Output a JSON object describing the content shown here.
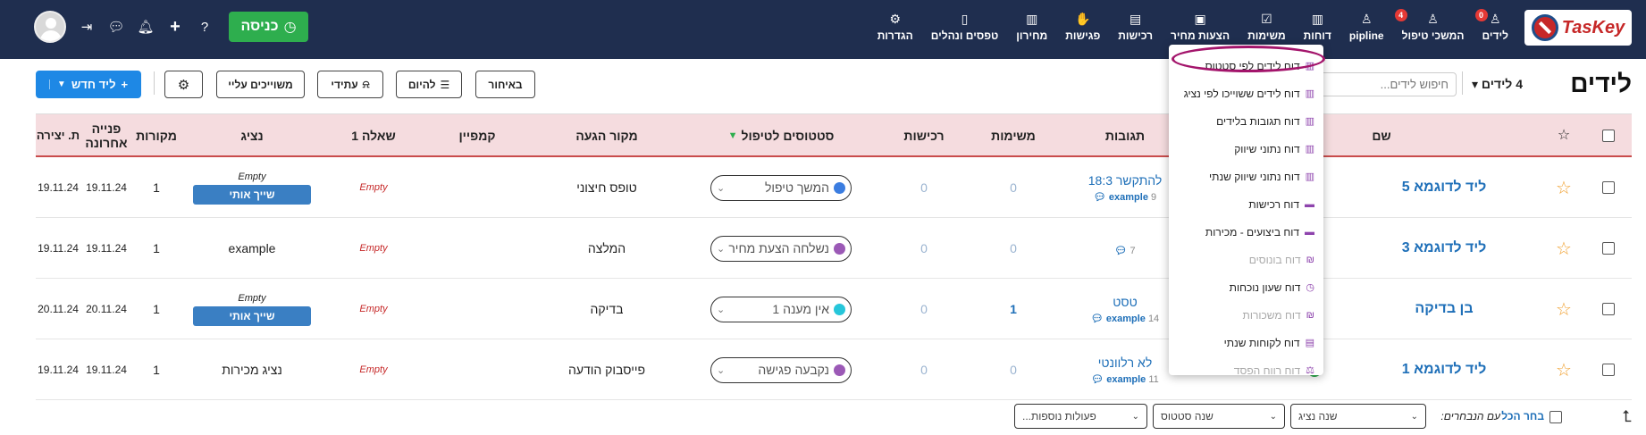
{
  "nav": {
    "logo": "TasKey",
    "items": [
      {
        "label": "לידים",
        "icon": "users-icon",
        "badge": "0"
      },
      {
        "label": "המשכי טיפול",
        "icon": "user-followup-icon",
        "badge": "4"
      },
      {
        "label": "pipline",
        "icon": "pipeline-icon",
        "badge": ""
      },
      {
        "label": "דוחות",
        "icon": "bar-chart-icon",
        "badge": ""
      },
      {
        "label": "משימות",
        "icon": "checkbox-icon",
        "badge": ""
      },
      {
        "label": "הצעות מחיר",
        "icon": "quote-icon",
        "badge": ""
      },
      {
        "label": "רכישות",
        "icon": "purchase-icon",
        "badge": ""
      },
      {
        "label": "פגישות",
        "icon": "handshake-icon",
        "badge": ""
      },
      {
        "label": "מחירון",
        "icon": "barcode-icon",
        "badge": ""
      },
      {
        "label": "טפסים ונהלים",
        "icon": "forms-icon",
        "badge": ""
      },
      {
        "label": "הגדרות",
        "icon": "gear-icon",
        "badge": ""
      }
    ],
    "enter_button": "כניסה"
  },
  "header": {
    "title": "לידים",
    "leads_count": "4 לידים",
    "search_placeholder": "חיפוש לידים...",
    "btn_late": "באיחור",
    "btn_today": "להיום",
    "btn_future": "עתידי",
    "btn_assigned": "משוייכים עליי",
    "btn_new_lead": "ליד חדש"
  },
  "table": {
    "headers": {
      "name": "שם",
      "tags": "תגובות",
      "tasks": "משימות",
      "purchases": "רכישות",
      "status": "סטטוסים לטיפול",
      "source": "מקור הגעה",
      "campaign": "קמפיין",
      "question": "שאלה 1",
      "agent": "נציג",
      "sources": "מקורות",
      "last_contact": "פנייה אחרונה",
      "created": "ת. יצירה"
    },
    "rows": [
      {
        "name": "ליד לדוגמא 5",
        "tag": "להתקשר 18:3",
        "tag_sub": "example",
        "tag_count": "9",
        "tasks": "0",
        "purchases": "0",
        "status": "המשך טיפול",
        "status_color": "#3b7de0",
        "source": "טופס חיצוני",
        "question": "Empty",
        "agent_empty": "Empty",
        "agent_btn": "שייך אותי",
        "agent": "",
        "sources": "1",
        "last": "19.11.24",
        "created": "19.11.24"
      },
      {
        "name": "ליד לדוגמא 3",
        "tag": "",
        "tag_sub": "",
        "tag_count": "7",
        "tasks": "0",
        "purchases": "0",
        "status": "נשלחה הצעת מחיר",
        "status_color": "#9b59b6",
        "source": "המלצה",
        "question": "Empty",
        "agent_empty": "",
        "agent_btn": "",
        "agent": "example",
        "sources": "1",
        "last": "19.11.24",
        "created": "19.11.24"
      },
      {
        "name": "בן בדיקה",
        "tag": "טסט",
        "tag_sub": "example",
        "tag_count": "14",
        "tasks": "1",
        "purchases": "0",
        "status": "אין מענה 1",
        "status_color": "#26c6da",
        "source": "בדיקה",
        "question": "Empty",
        "agent_empty": "Empty",
        "agent_btn": "שייך אותי",
        "agent": "",
        "sources": "1",
        "last": "20.11.24",
        "created": "20.11.24"
      },
      {
        "name": "ליד לדוגמא 1",
        "tag": "לא רלוונטי",
        "tag_sub": "example",
        "tag_count": "11",
        "tasks": "0",
        "purchases": "0",
        "status": "נקבעה פגישה",
        "status_color": "#9b59b6",
        "source": "פייסבוק הודעה",
        "question": "Empty",
        "agent_empty": "",
        "agent_btn": "",
        "agent": "נציג מכירות",
        "sources": "1",
        "last": "19.11.24",
        "created": "19.11.24"
      }
    ]
  },
  "reports_menu": {
    "items": [
      {
        "label": "דוח לידים לפי סטטוס",
        "icon": "bar-chart-icon",
        "disabled": false
      },
      {
        "label": "דוח לידים ששוייכו לפי נציג",
        "icon": "bar-chart-icon",
        "disabled": false
      },
      {
        "label": "דוח תגובות בלידים",
        "icon": "bar-chart-icon",
        "disabled": false
      },
      {
        "label": "דוח נתוני שיווק",
        "icon": "bar-chart-icon",
        "disabled": false
      },
      {
        "label": "דוח נתוני שיווק שנתי",
        "icon": "bar-chart-icon",
        "disabled": false
      },
      {
        "label": "דוח רכישות",
        "icon": "cart-icon",
        "disabled": false
      },
      {
        "label": "דוח ביצועים - מכירות",
        "icon": "cart-icon",
        "disabled": false
      },
      {
        "label": "דוח בונוסים",
        "icon": "shekel-icon",
        "disabled": true
      },
      {
        "label": "דוח שעון נוכחות",
        "icon": "clock-icon",
        "disabled": false
      },
      {
        "label": "דוח משכורות",
        "icon": "shekel-icon",
        "disabled": true
      },
      {
        "label": "דוח לקוחות שנתי",
        "icon": "document-icon",
        "disabled": false
      },
      {
        "label": "דוח רווח הפסד",
        "icon": "scale-icon",
        "disabled": true
      }
    ]
  },
  "bottom": {
    "select_all": "בחר הכל",
    "with_selected": "עם הנבחרים:",
    "change_agent": "שנה נציג",
    "change_status": "שנה סטטוס",
    "more_actions": "פעולות נוספות..."
  }
}
